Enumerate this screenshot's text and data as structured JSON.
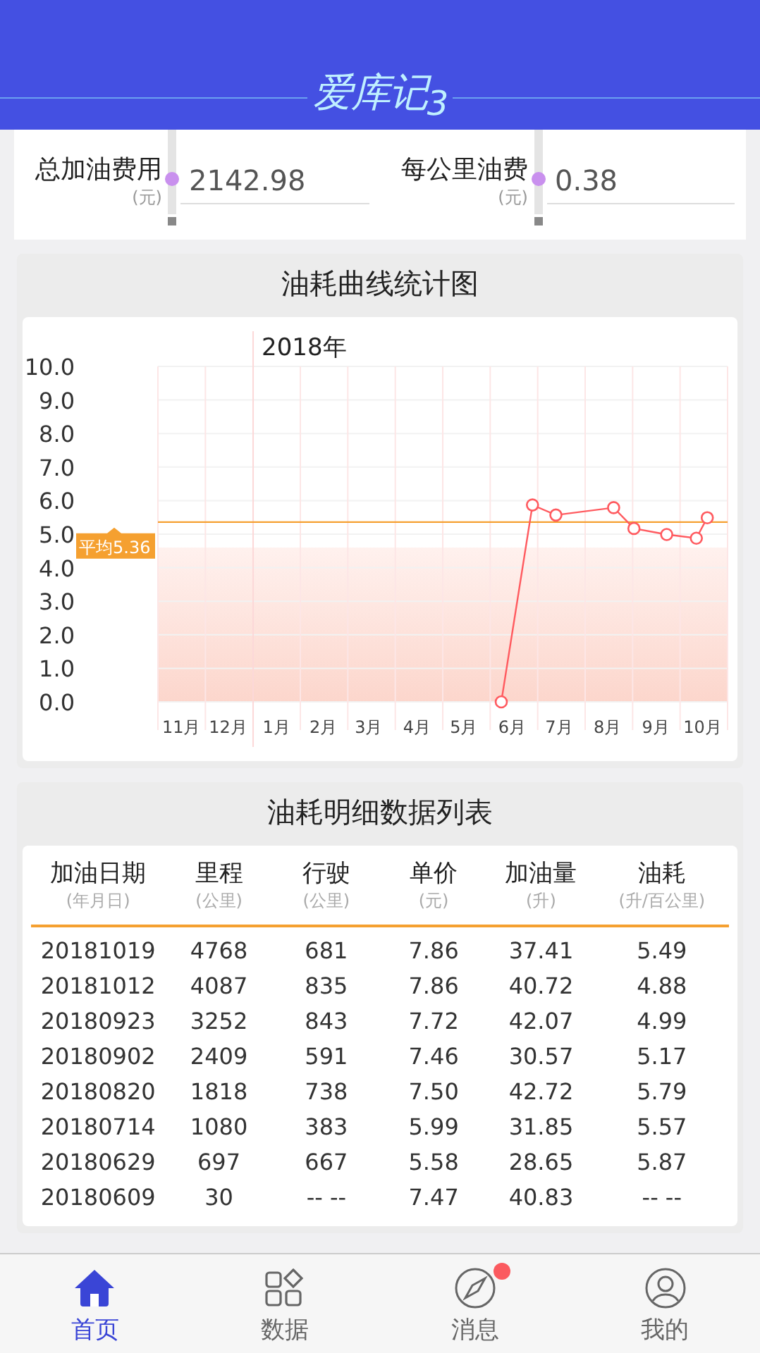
{
  "header": {
    "logo": "爱库记$_{3}$"
  },
  "stats": [
    {
      "label": "总加油费用",
      "unit": "(元)",
      "value": "2142.98"
    },
    {
      "label": "每公里油费",
      "unit": "(元)",
      "value": "0.38"
    }
  ],
  "chart_card": {
    "title": "油耗曲线统计图",
    "chart_data": {
      "type": "line",
      "x": [
        "2018-06-09",
        "2018-06-29",
        "2018-07-14",
        "2018-08-20",
        "2018-09-02",
        "2018-09-23",
        "2018-10-12",
        "2018-10-19"
      ],
      "xlim": [
        "2017-11-01",
        "2018-11-01"
      ],
      "xticks": [
        {
          "value": "2017-11-16",
          "label": "11月"
        },
        {
          "value": "2017-12-16",
          "label": "12月"
        },
        {
          "value": "2018-01-16",
          "label": "1月"
        },
        {
          "value": "2018-02-15",
          "label": "2月"
        },
        {
          "value": "2018-03-16",
          "label": "3月"
        },
        {
          "value": "2018-04-16",
          "label": "4月"
        },
        {
          "value": "2018-05-16",
          "label": "5月"
        },
        {
          "value": "2018-06-16",
          "label": "6月"
        },
        {
          "value": "2018-07-16",
          "label": "7月"
        },
        {
          "value": "2018-08-16",
          "label": "8月"
        },
        {
          "value": "2018-09-16",
          "label": "9月"
        },
        {
          "value": "2018-10-16",
          "label": "10月"
        }
      ],
      "ylim": [
        0,
        10
      ],
      "yticks": [
        {
          "value": 0,
          "label": "0.0"
        },
        {
          "value": 1,
          "label": "1.0"
        },
        {
          "value": 2,
          "label": "2.0"
        },
        {
          "value": 3,
          "label": "3.0"
        },
        {
          "value": 4,
          "label": "4.0"
        },
        {
          "value": 5,
          "label": "5.0"
        },
        {
          "value": 6,
          "label": "6.0"
        },
        {
          "value": 7,
          "label": "7.0"
        },
        {
          "value": 8,
          "label": "8.0"
        },
        {
          "value": 9,
          "label": "9.0"
        },
        {
          "value": 10,
          "label": "10.0"
        }
      ],
      "grid": true,
      "series": [
        {
          "color": "#ff5a5f",
          "marker": "circle",
          "values": [
            0,
            5.87,
            5.57,
            5.79,
            5.17,
            4.99,
            4.88,
            5.49
          ]
        }
      ],
      "ref_lines": [
        {
          "axis": "x",
          "value": "2018-01-01",
          "label": "2018年",
          "color": "#fcd8d8"
        },
        {
          "axis": "y",
          "value": 5.36,
          "label": "平均5.36",
          "color": "#f5a030"
        }
      ]
    }
  },
  "table_card": {
    "title": "油耗明细数据列表",
    "columns": [
      {
        "name": "加油日期",
        "unit": "(年月日)"
      },
      {
        "name": "里程",
        "unit": "(公里)"
      },
      {
        "name": "行驶",
        "unit": "(公里)"
      },
      {
        "name": "单价",
        "unit": "(元)"
      },
      {
        "name": "加油量",
        "unit": "(升)"
      },
      {
        "name": "油耗",
        "unit": "(升/百公里)"
      }
    ],
    "rows": [
      [
        "20181019",
        "4768",
        "681",
        "7.86",
        "37.41",
        "5.49"
      ],
      [
        "20181012",
        "4087",
        "835",
        "7.86",
        "40.72",
        "4.88"
      ],
      [
        "20180923",
        "3252",
        "843",
        "7.72",
        "42.07",
        "4.99"
      ],
      [
        "20180902",
        "2409",
        "591",
        "7.46",
        "30.57",
        "5.17"
      ],
      [
        "20180820",
        "1818",
        "738",
        "7.50",
        "42.72",
        "5.79"
      ],
      [
        "20180714",
        "1080",
        "383",
        "5.99",
        "31.85",
        "5.57"
      ],
      [
        "20180629",
        "697",
        "667",
        "5.58",
        "28.65",
        "5.87"
      ],
      [
        "20180609",
        "30",
        "-- --",
        "7.47",
        "40.83",
        "-- --"
      ]
    ]
  },
  "tab_bar": [
    {
      "kind": "home",
      "label": "首页",
      "selected": true,
      "badge": false
    },
    {
      "kind": "data",
      "label": "数据",
      "selected": false,
      "badge": false
    },
    {
      "kind": "compass",
      "label": "消息",
      "selected": false,
      "badge": true
    },
    {
      "kind": "user",
      "label": "我的",
      "selected": false,
      "badge": false
    }
  ]
}
